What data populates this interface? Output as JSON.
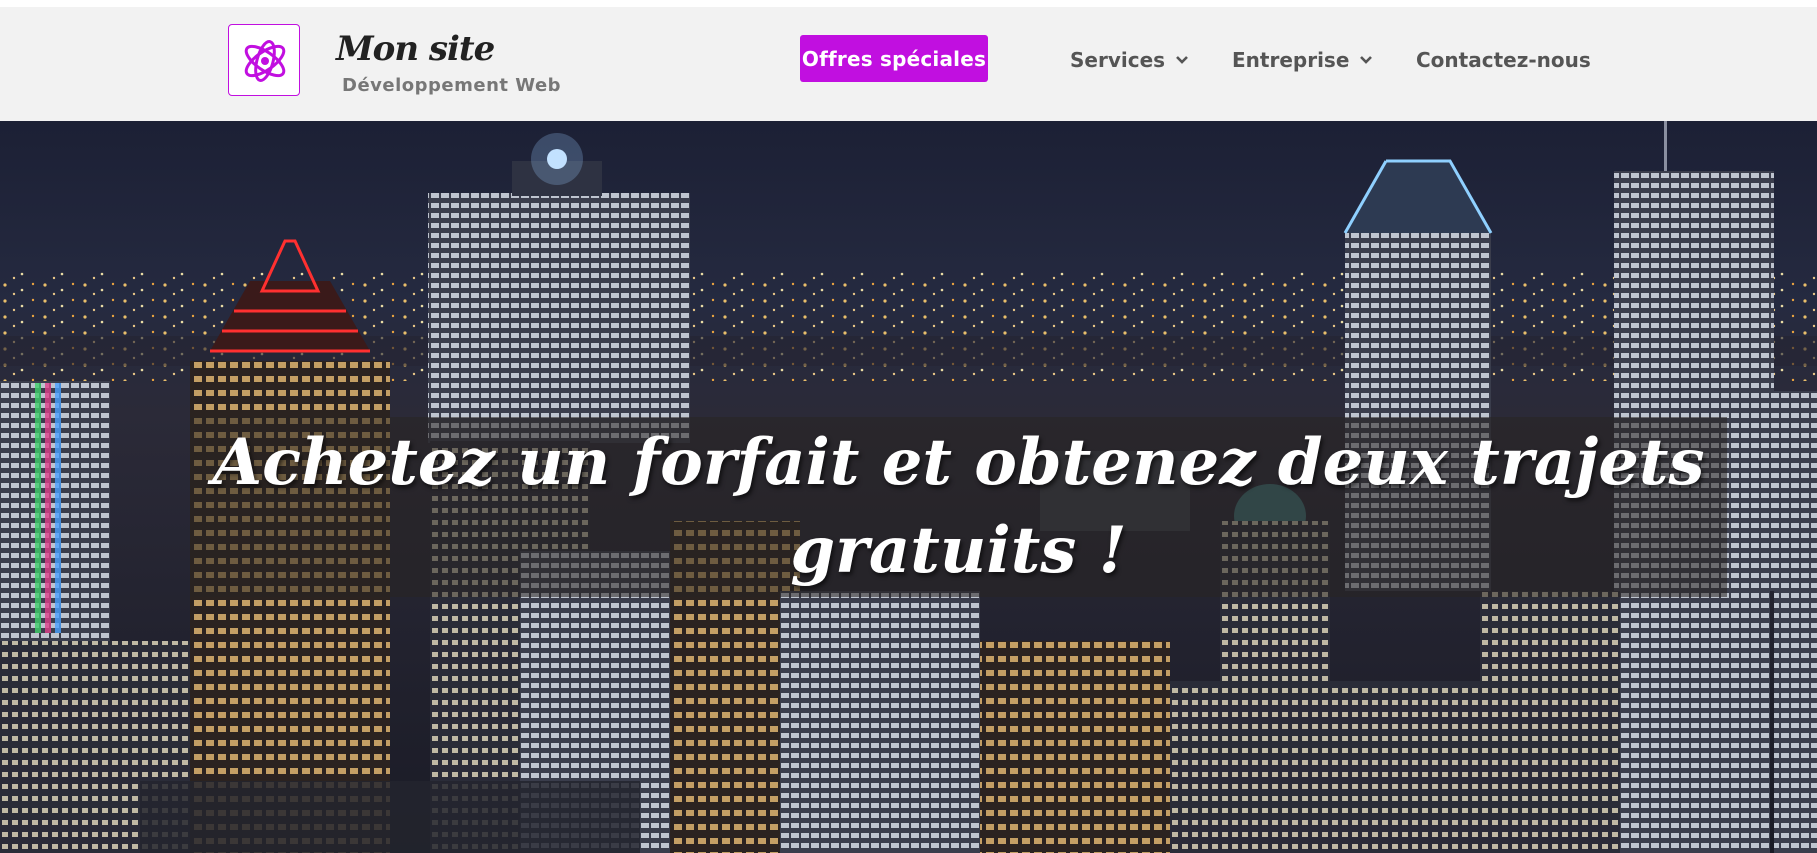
{
  "header": {
    "site_title": "Mon site",
    "tagline": "Développement Web",
    "promo_button": "Offres spéciales",
    "nav": [
      {
        "label": "Services",
        "has_dropdown": true
      },
      {
        "label": "Entreprise",
        "has_dropdown": true
      },
      {
        "label": "Contactez-nous",
        "has_dropdown": false
      }
    ]
  },
  "hero": {
    "title": "Achetez un forfait et obtenez deux trajets gratuits !"
  },
  "colors": {
    "accent": "#c10fe0",
    "header_bg": "#f2f2f2",
    "nav_text": "#555555",
    "sky": "#1e2236"
  },
  "icons": {
    "logo": "purple-orbit-logo-icon",
    "dropdown": "chevron-down-icon"
  }
}
